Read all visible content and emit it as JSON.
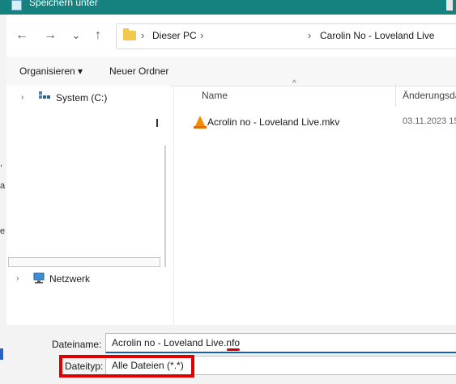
{
  "window": {
    "title": "Speichern unter"
  },
  "nav": {
    "back": "←",
    "forward": "→",
    "recent": "⌄",
    "up": "↑"
  },
  "address": {
    "segment1": "Dieser PC",
    "segment2": "Carolin No - Loveland Live",
    "sep": "›"
  },
  "toolbar": {
    "organize": "Organisieren ▾",
    "new_folder": "Neuer Ordner"
  },
  "sidebar": {
    "items": [
      {
        "label": "System (C:)",
        "chevron": "›"
      },
      {
        "label": "Netzwerk",
        "chevron": "›"
      }
    ]
  },
  "columns": {
    "name": "Name",
    "modified": "Änderungsda"
  },
  "files": [
    {
      "name": "Acrolin no - Loveland Live.mkv",
      "modified": "03.11.2023 15"
    }
  ],
  "save": {
    "filename_label": "Dateiname:",
    "filename_value": "Acrolin no - Loveland Live.nfo",
    "filetype_label": "Dateityp:",
    "filetype_value": "Alle Dateien  (*.*)"
  },
  "background_chars": [
    ",",
    "a",
    "e"
  ],
  "colors": {
    "titlebar": "#16827f",
    "highlight": "#e10000",
    "accent": "#1560b3",
    "vlc": "#f48b00"
  }
}
